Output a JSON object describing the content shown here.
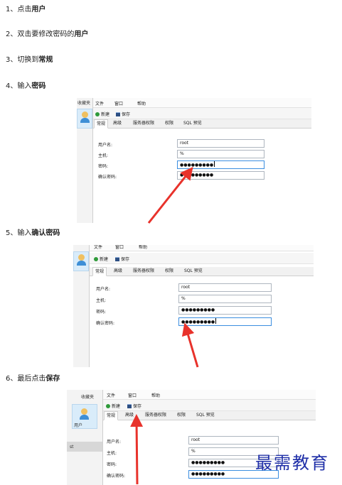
{
  "steps": [
    {
      "num": "1、",
      "text": "点击",
      "bold": "用户"
    },
    {
      "num": "2、",
      "text": "双击要修改密码的",
      "bold": "用户"
    },
    {
      "num": "3、",
      "text": "切换到",
      "bold": "常规"
    },
    {
      "num": "4、",
      "text": "输入",
      "bold": "密码"
    },
    {
      "num": "5、",
      "text": "输入",
      "bold": "确认密码"
    },
    {
      "num": "6、",
      "text": "最后点击",
      "bold": "保存"
    }
  ],
  "app": {
    "menu": [
      "文件",
      "窗口",
      "帮助"
    ],
    "favorites": "收藏夹",
    "user_label": "用户",
    "side_bottom_fragment": "st",
    "toolbar": {
      "new": "新建",
      "save": "保存"
    },
    "tabs": [
      "常规",
      "高级",
      "服务器权限",
      "权限",
      "SQL 预览"
    ],
    "form": {
      "username_label": "用户名:",
      "host_label": "主机:",
      "password_label": "密码:",
      "confirm_label": "确认密码:",
      "username_value": "root",
      "host_value": "%",
      "password_masked": "●●●●●●●●●",
      "confirm_masked": "●●●●●●●●●"
    }
  },
  "watermark": "最需教育",
  "colors": {
    "arrow": "#e8322b",
    "focus_border": "#3b8ee0",
    "watermark": "#1f2fa8"
  }
}
